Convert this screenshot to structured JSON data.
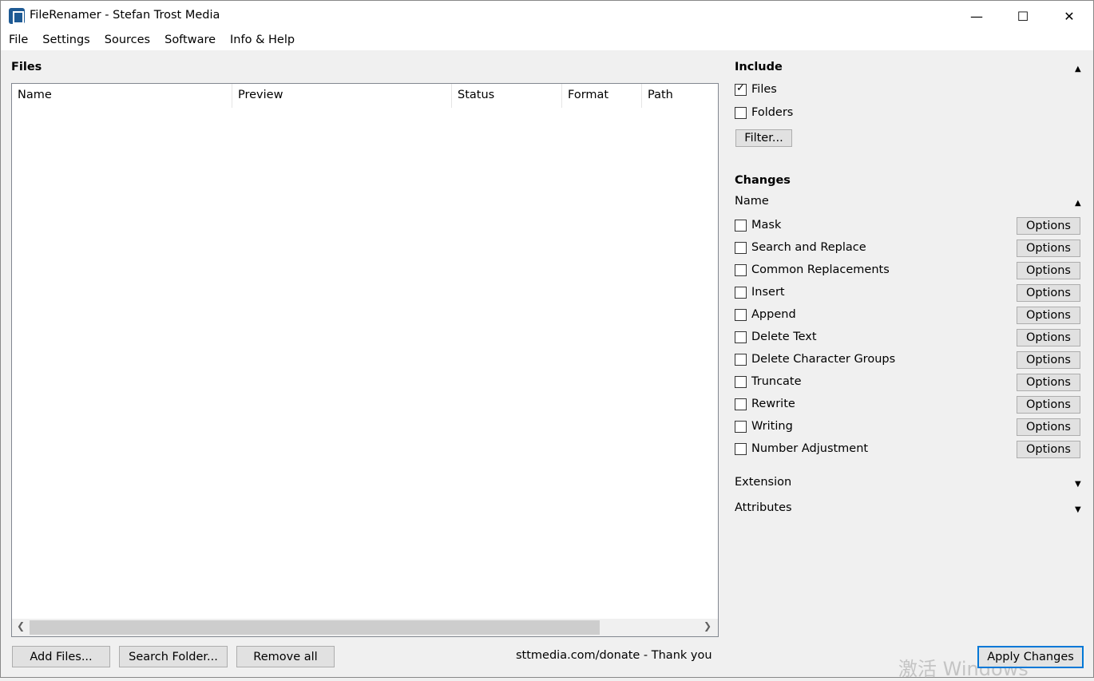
{
  "window": {
    "title": "FileRenamer - Stefan Trost Media",
    "minimize": "—",
    "maximize": "☐",
    "close": "✕"
  },
  "menu": [
    "File",
    "Settings",
    "Sources",
    "Software",
    "Info & Help"
  ],
  "files": {
    "title": "Files",
    "columns": [
      "Name",
      "Preview",
      "Status",
      "Format",
      "Path"
    ],
    "rows": []
  },
  "buttons": {
    "add_files": "Add Files...",
    "search_folder": "Search Folder...",
    "remove_all": "Remove all",
    "apply": "Apply Changes"
  },
  "donate": "sttmedia.com/donate - Thank you",
  "include": {
    "title": "Include",
    "files_label": "Files",
    "files_checked": true,
    "folders_label": "Folders",
    "folders_checked": false,
    "filter": "Filter..."
  },
  "changes": {
    "title": "Changes",
    "name_section": "Name",
    "options_label": "Options",
    "items": [
      "Mask",
      "Search and Replace",
      "Common Replacements",
      "Insert",
      "Append",
      "Delete Text",
      "Delete Character Groups",
      "Truncate",
      "Rewrite",
      "Writing",
      "Number Adjustment"
    ],
    "extension": "Extension",
    "attributes": "Attributes"
  },
  "watermark": "激活 Windows"
}
